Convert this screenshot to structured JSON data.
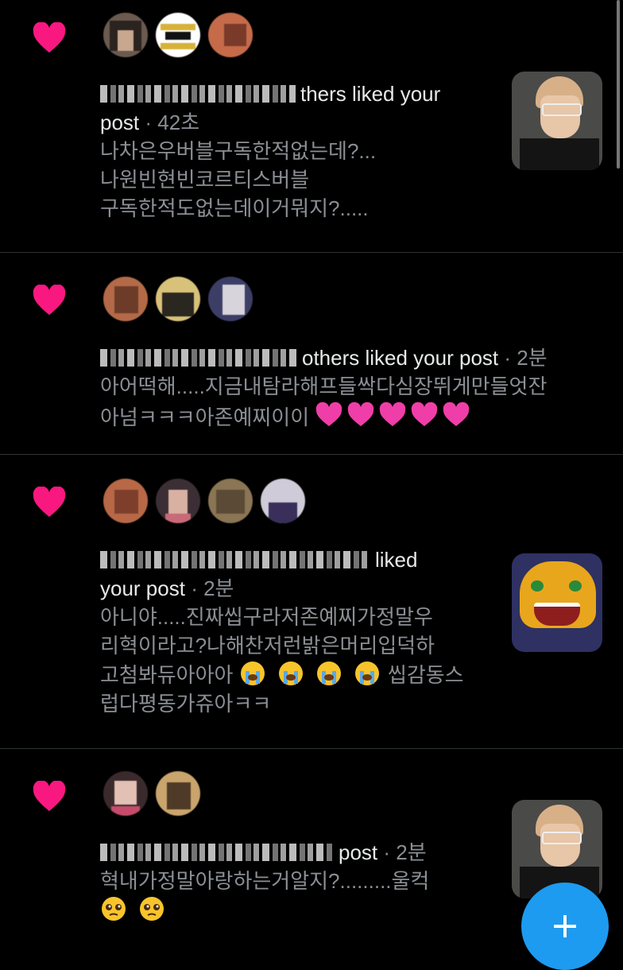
{
  "colors": {
    "heart": "#f91880",
    "accent": "#1d9bf0",
    "muted": "#8b8f94"
  },
  "notifications": [
    {
      "title_rest": "thers liked your",
      "title_line2": "post",
      "time": "· 42초",
      "lines": [
        "나차은우버블구독한적없는데?...",
        "나원빈현빈코르티스버블",
        "구독한적도없는데이거뭐지?....."
      ],
      "icon": "heart-icon"
    },
    {
      "title_rest": "others liked your post",
      "time": "· 2분",
      "lines": [
        "아어떡해.....지금내탐라해프들싹다심장뛰게만들엇잔",
        "아넘ㅋㅋㅋ아존예찌이이"
      ],
      "icon": "heart-icon"
    },
    {
      "title_rest": "liked",
      "title_line2": "your post",
      "time": "· 2분",
      "lines": [
        "아니야.....진짜씹구라저존예찌가정말우",
        "리혁이라고?나해찬저런밝은머리입덕하",
        "고첨봐듀아아아",
        "씹감동스",
        "럽다평동가쥬아ㅋㅋ"
      ],
      "icon": "heart-icon"
    },
    {
      "title_rest": "post",
      "time": "· 2분",
      "lines": [
        "혁내가정말아랑하는거알지?.........울컥"
      ],
      "icon": "heart-icon"
    }
  ],
  "fab": {
    "label": "+",
    "icon": "plus-icon"
  }
}
